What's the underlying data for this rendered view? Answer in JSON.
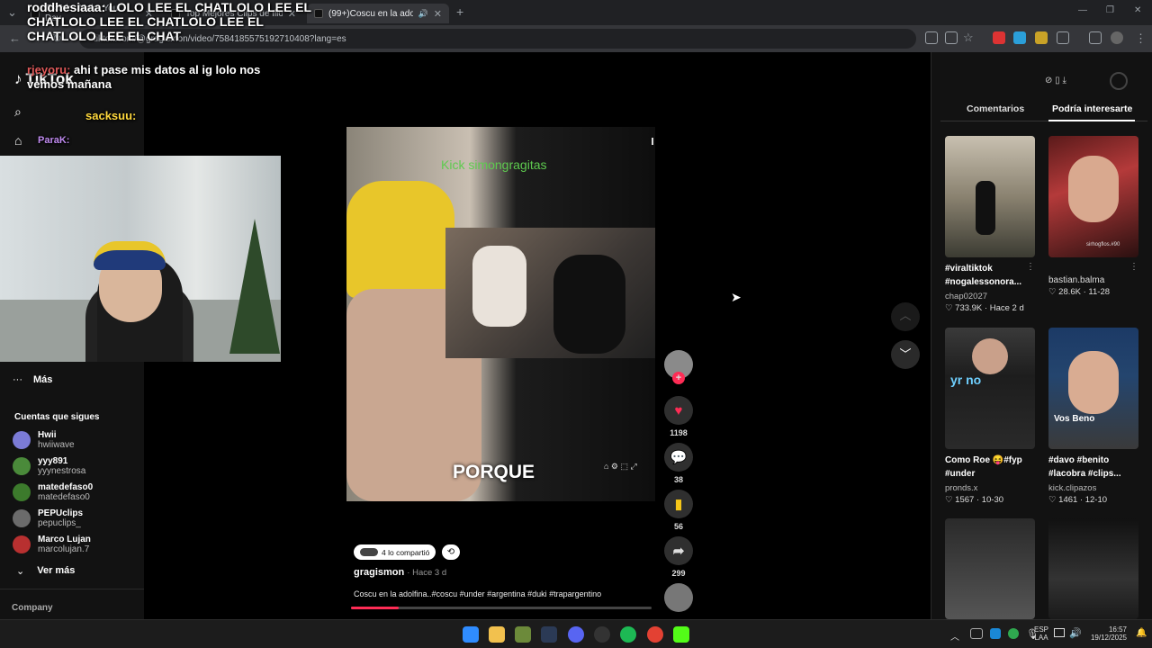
{
  "browser": {
    "tabs": [
      {
        "title": "TikTok - Make Your Day"
      },
      {
        "title": "Top Mejores Clips de Illojuan: M"
      },
      {
        "title": "(99+)Coscu en la adolfina.."
      }
    ],
    "new_tab": "+",
    "url": "tiktok.com/@gragismon/video/7584185575192710408?lang=es"
  },
  "stream_overlay": {
    "chat_line1": "roddhesiaaa: LOLO LEE EL CHATLOLO LEE EL CHATLOLO LEE EL CHATLOLO LEE EL CHATLOLO LEE EL CHAT",
    "chat_user2": "rjeyoru:",
    "chat_msg2": "ahi t pase mis datos al ig lolo nos vemos mañana",
    "chat_user3": "sacksuu:",
    "chat_user4": "ParaK:"
  },
  "tiktok": {
    "logo": "TikTok",
    "more_label": "Más",
    "following_heading": "Cuentas que sigues",
    "following": [
      {
        "name": "Hwii",
        "handle": "hwiiwave",
        "color": "#7b7bd6"
      },
      {
        "name": "yyy891",
        "handle": "yyynestrosa",
        "color": "#4a8a3a"
      },
      {
        "name": "matedefaso0",
        "handle": "matedefaso0",
        "color": "#3c7a2c"
      },
      {
        "name": "PEPUclips",
        "handle": "pepuclips_",
        "color": "#6b6b6b"
      },
      {
        "name": "Marco Lujan",
        "handle": "marcolujan.7",
        "color": "#b83030"
      }
    ],
    "see_more": "Ver más",
    "company": "Company",
    "video": {
      "overlay_top": "Kick simongragitas",
      "caption_word": "PORQUE",
      "shared_label": "4 lo compartió",
      "author": "gragismon",
      "time": "· Hace 3 d",
      "description": "Coscu en la adolfina..#coscu #under #argentina #duki #trapargentino",
      "progress": 0.16
    },
    "actions": {
      "likes": "1198",
      "comments": "38",
      "saves": "56",
      "shares": "299"
    },
    "right_tabs": {
      "comments": "Comentarios",
      "interests": "Podría interesarte"
    },
    "suggestions": [
      {
        "caption": "#viraltiktok #nogalessonora...",
        "author": "chap02027",
        "stats": "733.9K · Hace 2 d"
      },
      {
        "caption": "",
        "author": "bastian.balma",
        "stats": "28.6K · 11-28"
      },
      {
        "caption": "Como Roe 😝#fyp #under",
        "author": "pronds.x",
        "stats": "1567 · 10-30"
      },
      {
        "caption": "#davo #benito #lacobra #clips...",
        "author": "kick.clipazos",
        "stats": "1461 · 12-10"
      }
    ],
    "thumb_text": {
      "t2": "sirhogflos.#90",
      "t4a": "Vos Beno",
      "t3": "yr no"
    }
  },
  "taskbar": {
    "lang": "ESP",
    "lang2": "LAA",
    "time": "16:57",
    "date": "19/12/2025"
  }
}
